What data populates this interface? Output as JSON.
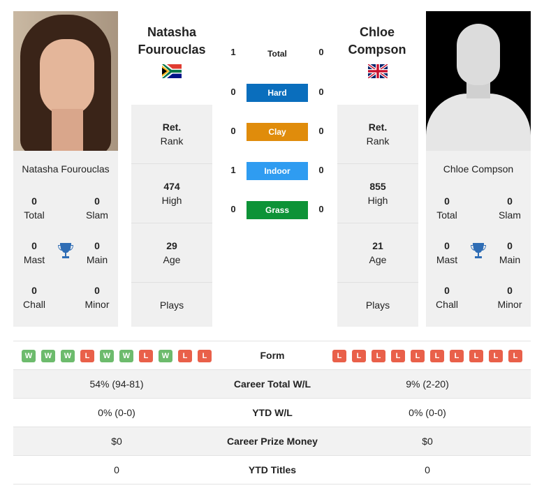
{
  "player1": {
    "name_line1": "Natasha",
    "name_line2": "Fourouclas",
    "full_name": "Natasha Fourouclas",
    "flag": "south-africa-flag",
    "titles": {
      "total": {
        "value": "0",
        "label": "Total"
      },
      "slam": {
        "value": "0",
        "label": "Slam"
      },
      "mast": {
        "value": "0",
        "label": "Mast"
      },
      "main": {
        "value": "0",
        "label": "Main"
      },
      "chall": {
        "value": "0",
        "label": "Chall"
      },
      "minor": {
        "value": "0",
        "label": "Minor"
      }
    },
    "rank": {
      "value": "Ret.",
      "label": "Rank"
    },
    "high": {
      "value": "474",
      "label": "High"
    },
    "age": {
      "value": "29",
      "label": "Age"
    },
    "plays": {
      "label": "Plays"
    },
    "form": [
      "W",
      "W",
      "W",
      "L",
      "W",
      "W",
      "L",
      "W",
      "L",
      "L"
    ]
  },
  "player2": {
    "name_line1": "Chloe",
    "name_line2": "Compson",
    "full_name": "Chloe Compson",
    "flag": "uk-flag",
    "titles": {
      "total": {
        "value": "0",
        "label": "Total"
      },
      "slam": {
        "value": "0",
        "label": "Slam"
      },
      "mast": {
        "value": "0",
        "label": "Mast"
      },
      "main": {
        "value": "0",
        "label": "Main"
      },
      "chall": {
        "value": "0",
        "label": "Chall"
      },
      "minor": {
        "value": "0",
        "label": "Minor"
      }
    },
    "rank": {
      "value": "Ret.",
      "label": "Rank"
    },
    "high": {
      "value": "855",
      "label": "High"
    },
    "age": {
      "value": "21",
      "label": "Age"
    },
    "plays": {
      "label": "Plays"
    },
    "form": [
      "L",
      "L",
      "L",
      "L",
      "L",
      "L",
      "L",
      "L",
      "L",
      "L"
    ]
  },
  "h2h": {
    "total": {
      "label": "Total",
      "p1": "1",
      "p2": "0"
    },
    "surfaces": [
      {
        "label": "Hard",
        "p1": "0",
        "p2": "0",
        "color": "#0a6ebd"
      },
      {
        "label": "Clay",
        "p1": "0",
        "p2": "0",
        "color": "#e08c0b"
      },
      {
        "label": "Indoor",
        "p1": "1",
        "p2": "0",
        "color": "#2f9cf1"
      },
      {
        "label": "Grass",
        "p1": "0",
        "p2": "0",
        "color": "#0d9337"
      }
    ]
  },
  "form_label": "Form",
  "stats": [
    {
      "label": "Career Total W/L",
      "p1": "54% (94-81)",
      "p2": "9% (2-20)"
    },
    {
      "label": "YTD W/L",
      "p1": "0% (0-0)",
      "p2": "0% (0-0)"
    },
    {
      "label": "Career Prize Money",
      "p1": "$0",
      "p2": "$0"
    },
    {
      "label": "YTD Titles",
      "p1": "0",
      "p2": "0"
    }
  ]
}
